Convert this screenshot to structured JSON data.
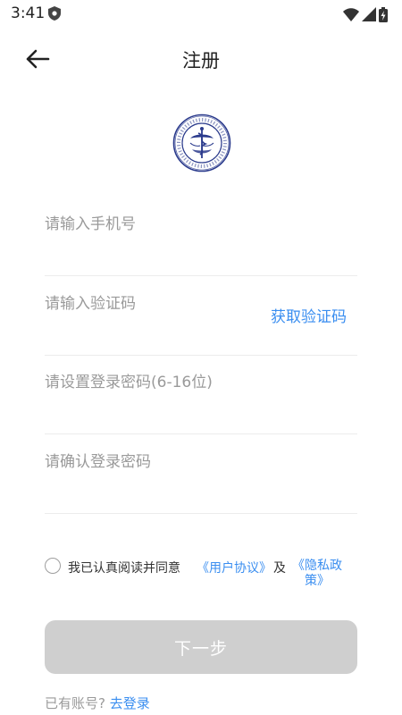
{
  "status_bar": {
    "time": "3:41",
    "icons": [
      "shield-icon",
      "wifi-icon",
      "signal-icon",
      "battery-charging-icon"
    ]
  },
  "header": {
    "title": "注册",
    "back_icon": "arrow-left-icon"
  },
  "logo": {
    "icon": "health-commission-seal-logo"
  },
  "form": {
    "phone_placeholder": "请输入手机号",
    "code_placeholder": "请输入验证码",
    "get_code_label": "获取验证码",
    "password_placeholder": "请设置登录密码(6-16位)",
    "confirm_placeholder": "请确认登录密码"
  },
  "agreement": {
    "text": "我已认真阅读并同意",
    "user_agreement": "《用户协议》",
    "and": "及",
    "privacy_policy": "《隐私政策》"
  },
  "next_button": "下一步",
  "login": {
    "question": "已有账号?",
    "link": "去登录"
  },
  "colors": {
    "accent": "#3a8ef0",
    "button_disabled": "#cfcfcf",
    "placeholder": "#9a9a9a",
    "logo_blue": "#2a3a8c"
  }
}
